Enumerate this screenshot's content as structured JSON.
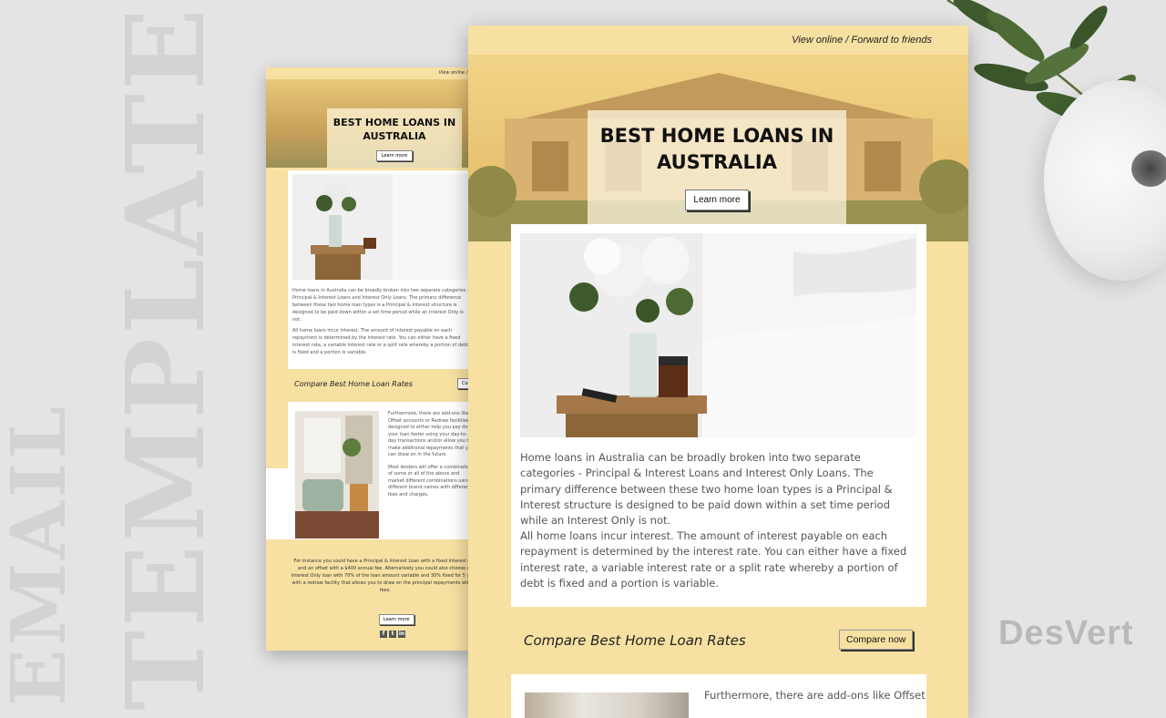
{
  "background": {
    "word_email": "EMAIL",
    "word_template": "TEMPLATE",
    "brand": "DesVert"
  },
  "email": {
    "top_links": "View online  /  Forward to friends",
    "top_links_small": "View online  /  F",
    "hero_title": "BEST HOME LOANS IN AUSTRALIA",
    "hero_button": "Learn more",
    "paragraph1": "Home loans in Australia can be broadly broken into two separate categories - Principal & Interest Loans and Interest Only Loans. The primary difference between these two home loan types is a Principal & Interest structure is designed to be paid down within a set time period while an Interest Only is not.",
    "paragraph2": "All home loans incur interest. The amount of interest payable on each repayment is determined by the interest rate. You can either have a fixed interest rate, a variable interest rate or a split rate whereby a portion of debt is fixed and a portion is variable.",
    "compare_title": "Compare Best Home Loan Rates",
    "compare_button": "Compare now",
    "compare_button_small": "Com",
    "paragraph3_start": "Furthermore, there are add-ons like Offset",
    "small_paragraph3": "Furthermore, there are add-ons like Offset accounts or Redraw facilities designed to either help you pay down your loan faster using your day-to-day transactions and/or allow you to make additional repayments that you can draw on in the future.",
    "small_paragraph4": "Most lenders will offer a combination of some or all of the above and market different combinations using different brand names with different fees and charges.",
    "small_paragraph5": "For instance you could have a Principal & Interest Loan with a fixed interest rate and an offset with a $400 annual fee. Alternatively you could also choose an Interest Only loan with 70% of the loan amount variable and 30% fixed for 5 years with a redraw facility that allows you to draw on the principal repayments with no fees.",
    "footer_button": "Learn more",
    "social": [
      "f",
      "t",
      "in"
    ]
  },
  "colors": {
    "accent_yellow": "#f7e1a2",
    "background": "#e4e4e4"
  }
}
